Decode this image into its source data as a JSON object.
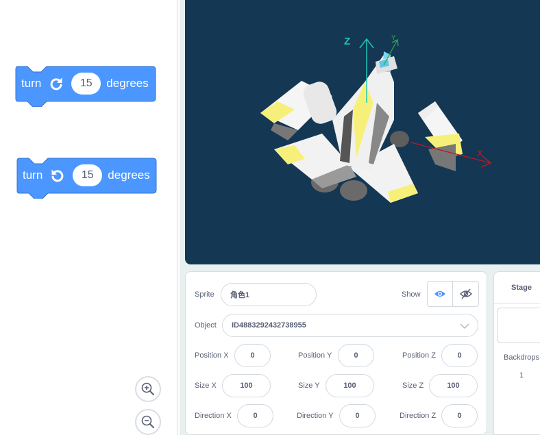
{
  "blocks": [
    {
      "word": "turn",
      "value": "15",
      "unit": "degrees",
      "icon": "rotate-right-icon"
    },
    {
      "word": "turn",
      "value": "15",
      "unit": "degrees",
      "icon": "rotate-left-icon"
    }
  ],
  "zoom": {
    "in_icon": "zoom-in-icon",
    "out_icon": "zoom-out-icon"
  },
  "stage": {
    "background": "#143754",
    "axes": {
      "z": "Z",
      "y": "Y",
      "x": "X"
    }
  },
  "sprite": {
    "sprite_label": "Sprite",
    "sprite_name": "角色1",
    "show_label": "Show",
    "object_label": "Object",
    "object_value": "ID4883292432738955",
    "position_x_label": "Position X",
    "position_x": "0",
    "position_y_label": "Position Y",
    "position_y": "0",
    "position_z_label": "Position Z",
    "position_z": "0",
    "size_x_label": "Size X",
    "size_x": "100",
    "size_y_label": "Size Y",
    "size_y": "100",
    "size_z_label": "Size Z",
    "size_z": "100",
    "direction_x_label": "Direction X",
    "direction_x": "0",
    "direction_y_label": "Direction Y",
    "direction_y": "0",
    "direction_z_label": "Direction Z",
    "direction_z": "0"
  },
  "stage_panel": {
    "title": "Stage",
    "backdrops_label": "Backdrops",
    "backdrops_count": "1"
  },
  "colors": {
    "block": "#4c97ff",
    "block_border": "#3373cc",
    "accent": "#4c97ff"
  }
}
